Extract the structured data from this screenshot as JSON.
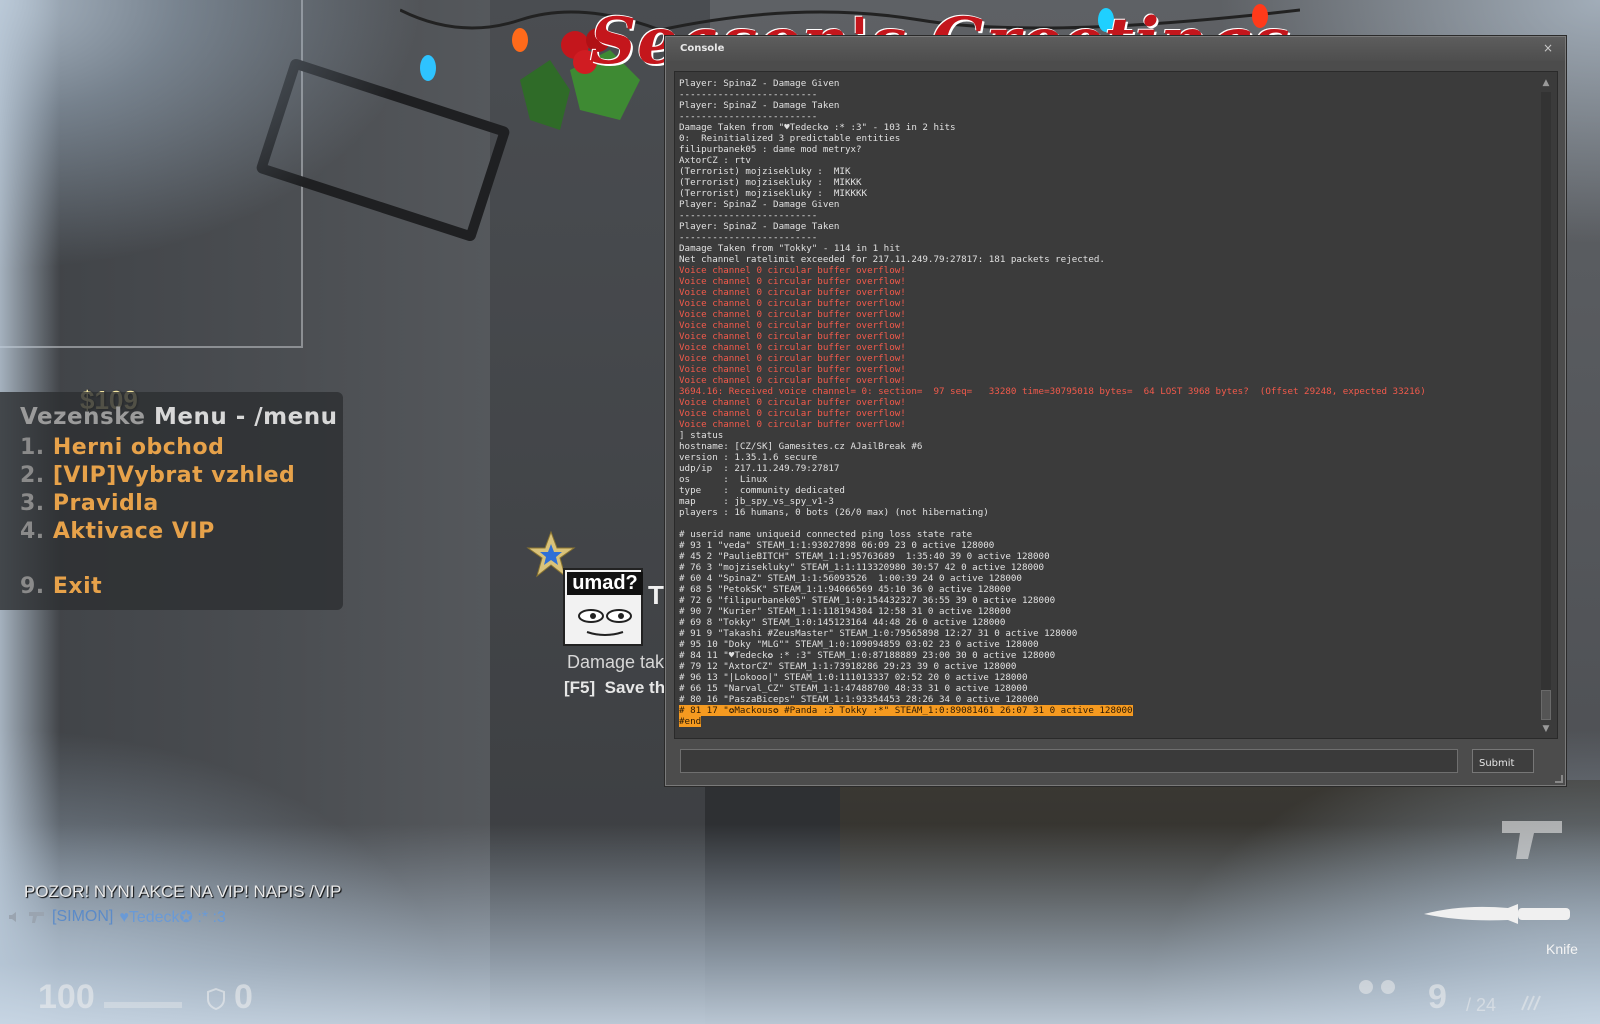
{
  "banner": {
    "text": "Season's Greetings"
  },
  "menu": {
    "money": "$109",
    "title_dim": "Vezenske",
    "title_rest": " Menu - /menu",
    "items": [
      {
        "num": "1.",
        "label": "Herni obchod"
      },
      {
        "num": "2.",
        "label": "[VIP]Vybrat vzhled"
      },
      {
        "num": "3.",
        "label": "Pravidla"
      },
      {
        "num": "4.",
        "label": "Aktivace VIP"
      },
      {
        "num": "9.",
        "label": "Exit"
      }
    ]
  },
  "damage_card": {
    "meme_text": "umad?",
    "initial": "T",
    "label": "Damage tak",
    "key": "[F5]",
    "action": "Save th"
  },
  "chat": {
    "line1": "POZOR! NYNI AKCE NA VIP! NAPIS /VIP",
    "line2_tag": "[SIMON]",
    "line2_name": "♥Tedeck✪ :* :3"
  },
  "hud": {
    "health": "100",
    "armor": "0",
    "ammo": "9",
    "reserve": "/ 24",
    "weapon": "Knife"
  },
  "console": {
    "title": "Console",
    "close": "×",
    "submit_label": "Submit",
    "input_value": "",
    "lines": [
      {
        "t": "Player: SpinaZ - Damage Given",
        "c": ""
      },
      {
        "t": "-------------------------",
        "c": ""
      },
      {
        "t": "Player: SpinaZ - Damage Taken",
        "c": ""
      },
      {
        "t": "-------------------------",
        "c": ""
      },
      {
        "t": "Damage Taken from \"♥Tedeck✪ :* :3\" - 103 in 2 hits",
        "c": ""
      },
      {
        "t": "0:  Reinitialized 3 predictable entities",
        "c": ""
      },
      {
        "t": "filipurbanek05 : dame mod metryx?",
        "c": ""
      },
      {
        "t": "AxtorCZ : rtv",
        "c": ""
      },
      {
        "t": "(Terrorist) mojzisekluky :  MIK",
        "c": ""
      },
      {
        "t": "(Terrorist) mojzisekluky :  MIKKK",
        "c": ""
      },
      {
        "t": "(Terrorist) mojzisekluky :  MIKKKK",
        "c": ""
      },
      {
        "t": "Player: SpinaZ - Damage Given",
        "c": ""
      },
      {
        "t": "-------------------------",
        "c": ""
      },
      {
        "t": "Player: SpinaZ - Damage Taken",
        "c": ""
      },
      {
        "t": "-------------------------",
        "c": ""
      },
      {
        "t": "Damage Taken from \"Tokky\" - 114 in 1 hit",
        "c": ""
      },
      {
        "t": "Net channel ratelimit exceeded for 217.11.249.79:27817: 181 packets rejected.",
        "c": ""
      },
      {
        "t": "Voice channel 0 circular buffer overflow!",
        "c": "red"
      },
      {
        "t": "Voice channel 0 circular buffer overflow!",
        "c": "red"
      },
      {
        "t": "Voice channel 0 circular buffer overflow!",
        "c": "red"
      },
      {
        "t": "Voice channel 0 circular buffer overflow!",
        "c": "red"
      },
      {
        "t": "Voice channel 0 circular buffer overflow!",
        "c": "red"
      },
      {
        "t": "Voice channel 0 circular buffer overflow!",
        "c": "red"
      },
      {
        "t": "Voice channel 0 circular buffer overflow!",
        "c": "red"
      },
      {
        "t": "Voice channel 0 circular buffer overflow!",
        "c": "red"
      },
      {
        "t": "Voice channel 0 circular buffer overflow!",
        "c": "red"
      },
      {
        "t": "Voice channel 0 circular buffer overflow!",
        "c": "red"
      },
      {
        "t": "Voice channel 0 circular buffer overflow!",
        "c": "red"
      },
      {
        "t": "3694.16: Received voice channel= 0: section=  97 seq=   33280 time=30795018 bytes=  64 LOST 3968 bytes?  (Offset 29248, expected 33216)",
        "c": "red"
      },
      {
        "t": "Voice channel 0 circular buffer overflow!",
        "c": "red"
      },
      {
        "t": "Voice channel 0 circular buffer overflow!",
        "c": "red"
      },
      {
        "t": "Voice channel 0 circular buffer overflow!",
        "c": "red"
      },
      {
        "t": "] status",
        "c": ""
      },
      {
        "t": "hostname: [CZ/SK] Gamesites.cz AJailBreak #6",
        "c": ""
      },
      {
        "t": "version : 1.35.1.6 secure",
        "c": ""
      },
      {
        "t": "udp/ip  : 217.11.249.79:27817",
        "c": ""
      },
      {
        "t": "os      :  Linux",
        "c": ""
      },
      {
        "t": "type    :  community dedicated",
        "c": ""
      },
      {
        "t": "map     : jb_spy_vs_spy_v1-3",
        "c": ""
      },
      {
        "t": "players : 16 humans, 0 bots (26/0 max) (not hibernating)",
        "c": ""
      },
      {
        "t": "",
        "c": ""
      },
      {
        "t": "# userid name uniqueid connected ping loss state rate",
        "c": ""
      },
      {
        "t": "# 93 1 \"veda\" STEAM_1:1:93027898 06:09 23 0 active 128000",
        "c": ""
      },
      {
        "t": "# 45 2 \"PaulieBITCH\" STEAM_1:1:95763689  1:35:40 39 0 active 128000",
        "c": ""
      },
      {
        "t": "# 76 3 \"mojzisekluky\" STEAM_1:1:113320980 30:57 42 0 active 128000",
        "c": ""
      },
      {
        "t": "# 60 4 \"SpinaZ\" STEAM_1:1:56093526  1:00:39 24 0 active 128000",
        "c": ""
      },
      {
        "t": "# 68 5 \"PetokSK\" STEAM_1:1:94066569 45:10 36 0 active 128000",
        "c": ""
      },
      {
        "t": "# 72 6 \"filipurbanek05\" STEAM_1:0:154432327 36:55 39 0 active 128000",
        "c": ""
      },
      {
        "t": "# 90 7 \"Kurier\" STEAM_1:1:118194304 12:58 31 0 active 128000",
        "c": ""
      },
      {
        "t": "# 69 8 \"Tokky\" STEAM_1:0:145123164 44:48 26 0 active 128000",
        "c": ""
      },
      {
        "t": "# 91 9 \"Takashi #ZeusMaster\" STEAM_1:0:79565898 12:27 31 0 active 128000",
        "c": ""
      },
      {
        "t": "# 95 10 \"Doky \"MLG\"\" STEAM_1:0:109094859 03:02 23 0 active 128000",
        "c": ""
      },
      {
        "t": "# 84 11 \"♥Tedeck✪ :* :3\" STEAM_1:0:87188889 23:00 30 0 active 128000",
        "c": ""
      },
      {
        "t": "# 79 12 \"AxtorCZ\" STEAM_1:1:73918286 29:23 39 0 active 128000",
        "c": ""
      },
      {
        "t": "# 96 13 \"|Lokooo|\" STEAM_1:0:111013337 02:52 20 0 active 128000",
        "c": ""
      },
      {
        "t": "# 66 15 \"Narval_CZ\" STEAM_1:1:47488700 48:33 31 0 active 128000",
        "c": ""
      },
      {
        "t": "# 80 16 \"PaszaBiceps\" STEAM_1:1:93354453 28:26 34 0 active 128000",
        "c": ""
      },
      {
        "t": "# 81 17 \"✪Mackous✪ #Panda :3 Tokky :*\" STEAM_1:0:89081461 26:07 31 0 active 128000",
        "c": "hl"
      },
      {
        "t": "#end",
        "c": "hl"
      }
    ]
  },
  "colors": {
    "menu_item": "#e7a24a",
    "console_red": "#f25a4b",
    "highlight": "#f59a20",
    "chat_blue": "#5c8bc8"
  }
}
